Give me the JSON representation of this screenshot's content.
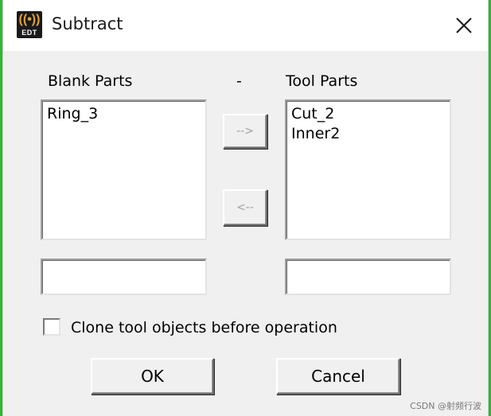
{
  "window": {
    "title": "Subtract",
    "app_icon": {
      "icon": "antenna-icon",
      "label": "EDT"
    }
  },
  "blank_parts": {
    "label": "Blank Parts",
    "items": [
      "Ring_3"
    ],
    "field_value": ""
  },
  "separator": "-",
  "tool_parts": {
    "label": "Tool Parts",
    "items": [
      "Cut_2",
      "Inner2"
    ],
    "field_value": ""
  },
  "move_right_label": "-->",
  "move_left_label": "<--",
  "clone_option": {
    "label": "Clone tool objects before operation",
    "checked": false
  },
  "buttons": {
    "ok": "OK",
    "cancel": "Cancel"
  },
  "watermark": "CSDN @射频行波"
}
